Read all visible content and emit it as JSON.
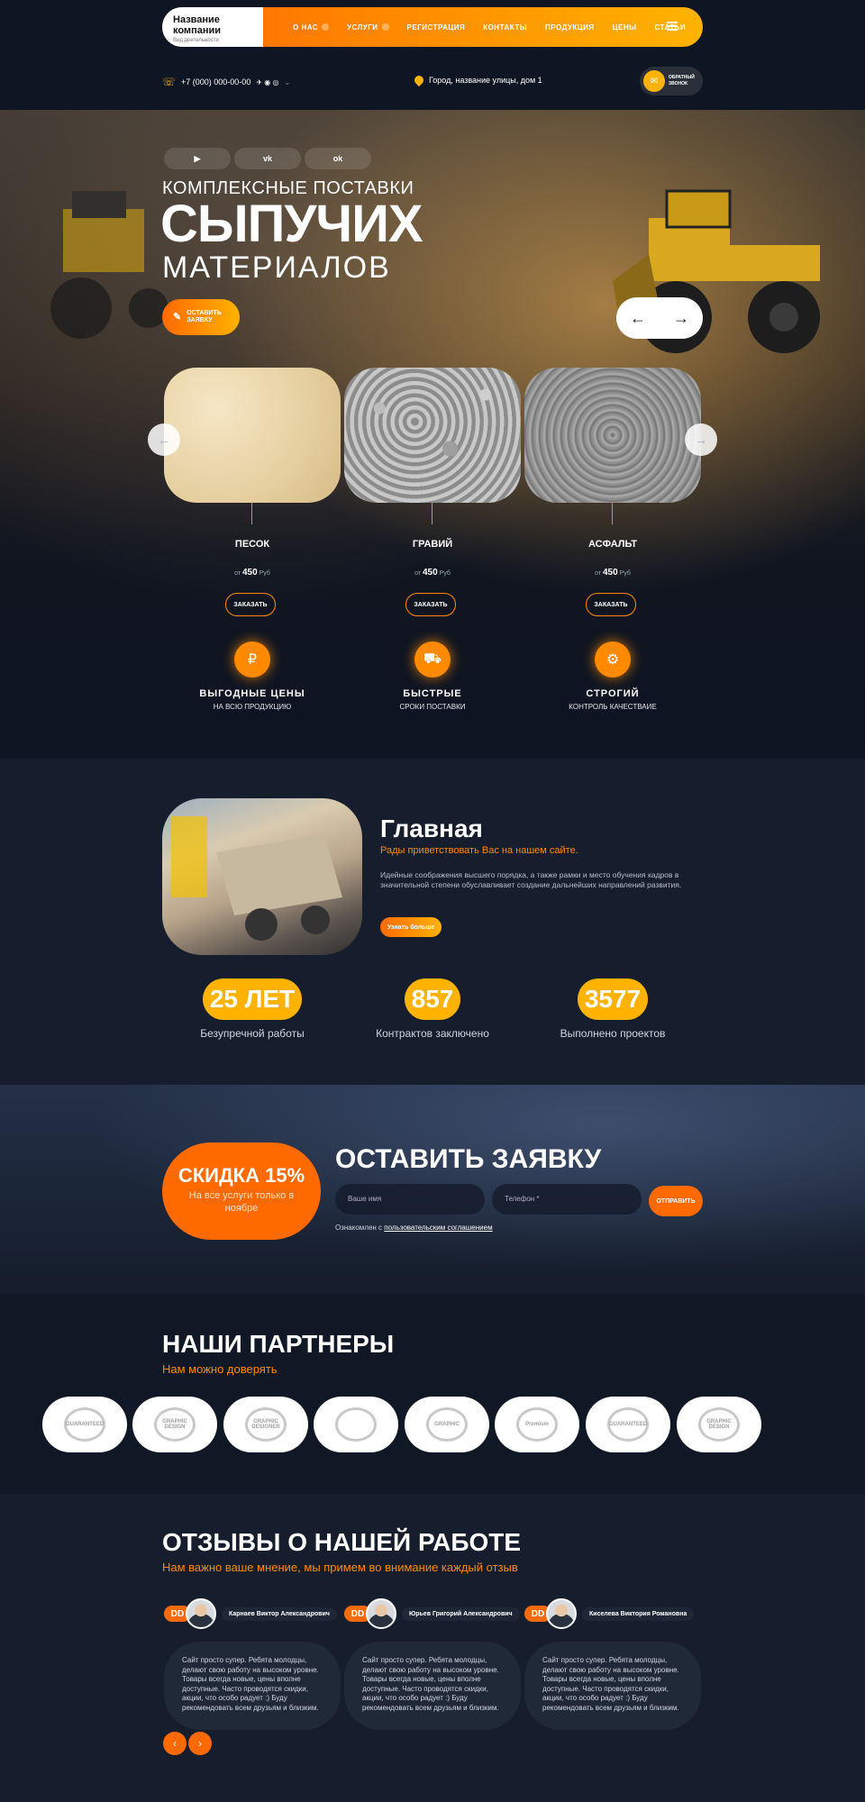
{
  "nav": {
    "company_name": "Название компании",
    "company_sub": "Вид деятельности",
    "items": [
      {
        "label": "О НАС"
      },
      {
        "label": "УСЛУГИ"
      },
      {
        "label": "РЕГИСТРАЦИЯ"
      },
      {
        "label": "КОНТАКТЫ"
      },
      {
        "label": "ПРОДУКЦИЯ"
      },
      {
        "label": "ЦЕНЫ"
      },
      {
        "label": "СТАТЬИ"
      }
    ]
  },
  "contacts": {
    "phone": "+7 (000) 000-00-00",
    "address": "Город, название улицы, дом 1",
    "callback": "ОБРАТНЫЙ ЗВОНОК"
  },
  "hero": {
    "socials": [
      "▶",
      "vk",
      "ok"
    ],
    "line1": "КОМПЛЕКСНЫЕ ПОСТАВКИ",
    "line2": "СЫПУЧИХ",
    "line3": "МАТЕРИАЛОВ",
    "request_btn": "ОСТАВИТЬ ЗАЯВКУ"
  },
  "products": [
    {
      "name": "ПЕСОК",
      "price_prefix": "от",
      "price": "450",
      "currency": "Руб",
      "btn": "ЗАКАЗАТЬ"
    },
    {
      "name": "ГРАВИЙ",
      "price_prefix": "от",
      "price": "450",
      "currency": "Руб",
      "btn": "ЗАКАЗАТЬ"
    },
    {
      "name": "АСФАЛЬТ",
      "price_prefix": "от",
      "price": "450",
      "currency": "Руб",
      "btn": "ЗАКАЗАТЬ"
    }
  ],
  "features": [
    {
      "title": "ВЫГОДНЫЕ ЦЕНЫ",
      "sub": "НА ВСЮ ПРОДУКЦИЮ"
    },
    {
      "title": "БЫСТРЫЕ",
      "sub": "СРОКИ ПОСТАВКИ"
    },
    {
      "title": "СТРОГИЙ",
      "sub": "КОНТРОЛЬ КАЧЕСТВАИЕ"
    }
  ],
  "about": {
    "title": "Главная",
    "subtitle": "Рады приветствовать Вас на нашем сайте.",
    "text": "Идейные соображения высшего порядка, а также рамки и место обучения кадров в значительной степени обуславливает создание дальнейших направлений развития.",
    "button": "Узнать больше",
    "stats": [
      {
        "value": "25 ЛЕТ",
        "label": "Безупречной работы"
      },
      {
        "value": "857",
        "label": "Контрактов заключено"
      },
      {
        "value": "3577",
        "label": "Выполнено проектов"
      }
    ]
  },
  "request": {
    "discount_title": "СКИДКА 15%",
    "discount_text": "На все услуги только в ноябре",
    "title": "ОСТАВИТЬ ЗАЯВКУ",
    "name_placeholder": "Ваше имя",
    "phone_placeholder": "Телефон *",
    "send": "ОТПРАВИТЬ",
    "consent_prefix": "Ознакомлен с",
    "consent_link": "пользовательским соглашением"
  },
  "partners": {
    "title": "НАШИ ПАРТНЕРЫ",
    "subtitle": "Нам можно доверять",
    "logos": [
      "GUARANTEED",
      "GRAPHIC DESIGN",
      "GRAPHIC DESIGNER",
      "",
      "GRAPHIC",
      "Premium",
      "GUARANTEED",
      "GRAPHIC DESIGN"
    ]
  },
  "reviews": {
    "title": "ОТЗЫВЫ О НАШЕЙ РАБОТЕ",
    "subtitle": "Нам важно ваше мнение, мы примем во внимание каждый отзыв",
    "items": [
      {
        "name": "Карнаев Виктор Александрович",
        "text": "Сайт просто супер. Ребята молодцы, делают свою работу на высоком уровне. Товары всегда новые, цены вполне доступные. Часто проводятся скидки, акции, что особо радует :) Буду рекомендовать всем друзьям и близким."
      },
      {
        "name": "Юрьев Григорий Александрович",
        "text": "Сайт просто супер. Ребята молодцы, делают свою работу на высоком уровне. Товары всегда новые, цены вполне доступные. Часто проводятся скидки, акции, что особо радует :) Буду рекомендовать всем друзьям и близким."
      },
      {
        "name": "Киселева Виктория Романовна",
        "text": "Сайт просто супер. Ребята молодцы, делают свою работу на высоком уровне. Товары всегда новые, цены вполне доступные. Часто проводятся скидки, акции, что особо радует :) Буду рекомендовать всем друзьям и близким."
      }
    ],
    "quote_mark": "DD"
  },
  "icons": {
    "arrow_left": "←",
    "arrow_right": "→",
    "chevron_left": "‹",
    "chevron_right": "›"
  },
  "colors": {
    "accent": "#ff6a00",
    "accent2": "#ffb300",
    "bg": "#0e1523"
  }
}
